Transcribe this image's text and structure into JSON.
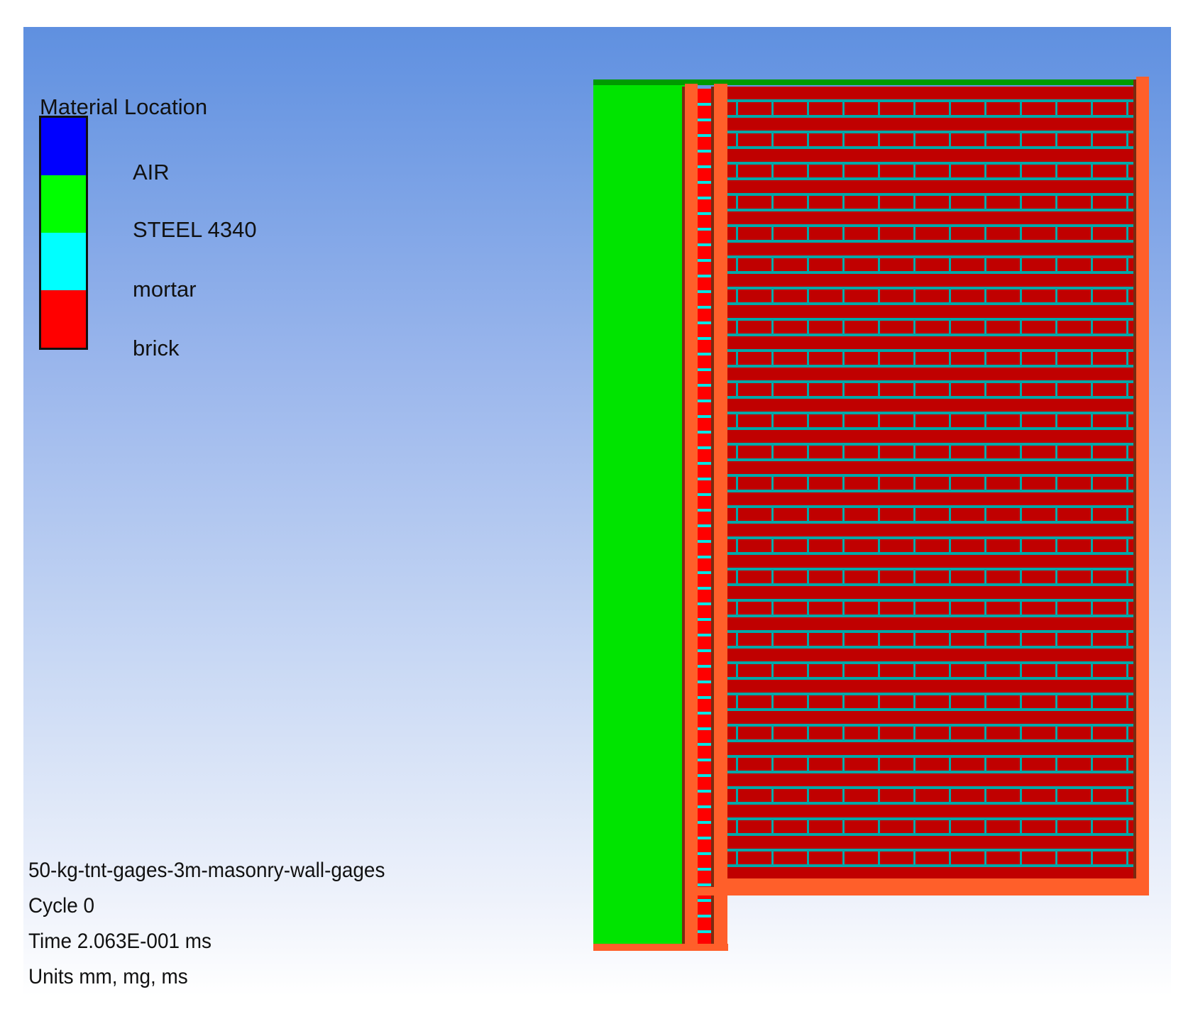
{
  "legend": {
    "title": "Material Location",
    "items": [
      {
        "label": "AIR",
        "color": "#0000ff"
      },
      {
        "label": "STEEL 4340",
        "color": "#00ff00"
      },
      {
        "label": "mortar",
        "color": "#00ffff"
      },
      {
        "label": "brick",
        "color": "#ff0000"
      }
    ]
  },
  "info": {
    "model_name": "50-kg-tnt-gages-3m-masonry-wall-gages",
    "cycle": "Cycle 0",
    "time": "Time 2.063E-001 ms",
    "units": "Units mm, mg, ms"
  },
  "render_colors": {
    "steel": "#00e400",
    "steel_top": "#009a00",
    "frame": "#ff5f2a",
    "frame_dark": "#7a2a10",
    "brick": "#c00000",
    "brick_strip": "#ff0000",
    "mortar": "#00a8a8",
    "mortar_strip": "#00e5e5"
  }
}
